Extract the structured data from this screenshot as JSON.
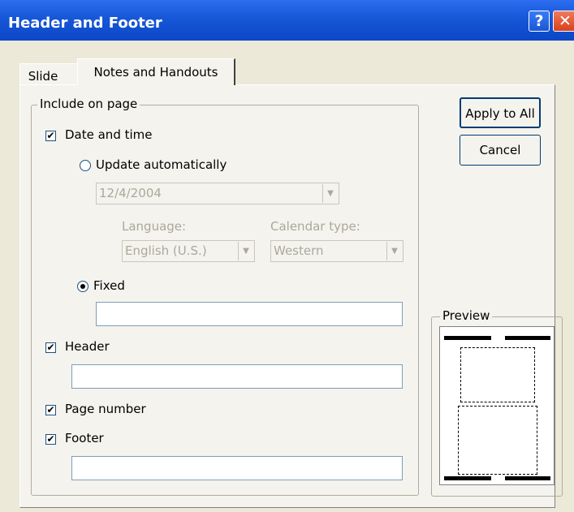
{
  "window": {
    "title": "Header and Footer",
    "help_label": "?",
    "close_label": "✕"
  },
  "tabs": [
    {
      "label": "Slide"
    },
    {
      "label": "Notes and Handouts"
    }
  ],
  "group": {
    "legend": "Include on page"
  },
  "date_time": {
    "label": "Date and time",
    "checked": true,
    "update_auto_label": "Update automatically",
    "date_value": "12/4/2004",
    "language_label": "Language:",
    "language_value": "English (U.S.)",
    "calendar_label": "Calendar type:",
    "calendar_value": "Western",
    "fixed_label": "Fixed",
    "fixed_value": ""
  },
  "header": {
    "label": "Header",
    "checked": true,
    "value": ""
  },
  "page_number": {
    "label": "Page number",
    "checked": true
  },
  "footer": {
    "label": "Footer",
    "checked": true,
    "value": ""
  },
  "buttons": {
    "apply_all": "Apply to All",
    "cancel": "Cancel"
  },
  "preview": {
    "legend": "Preview"
  }
}
